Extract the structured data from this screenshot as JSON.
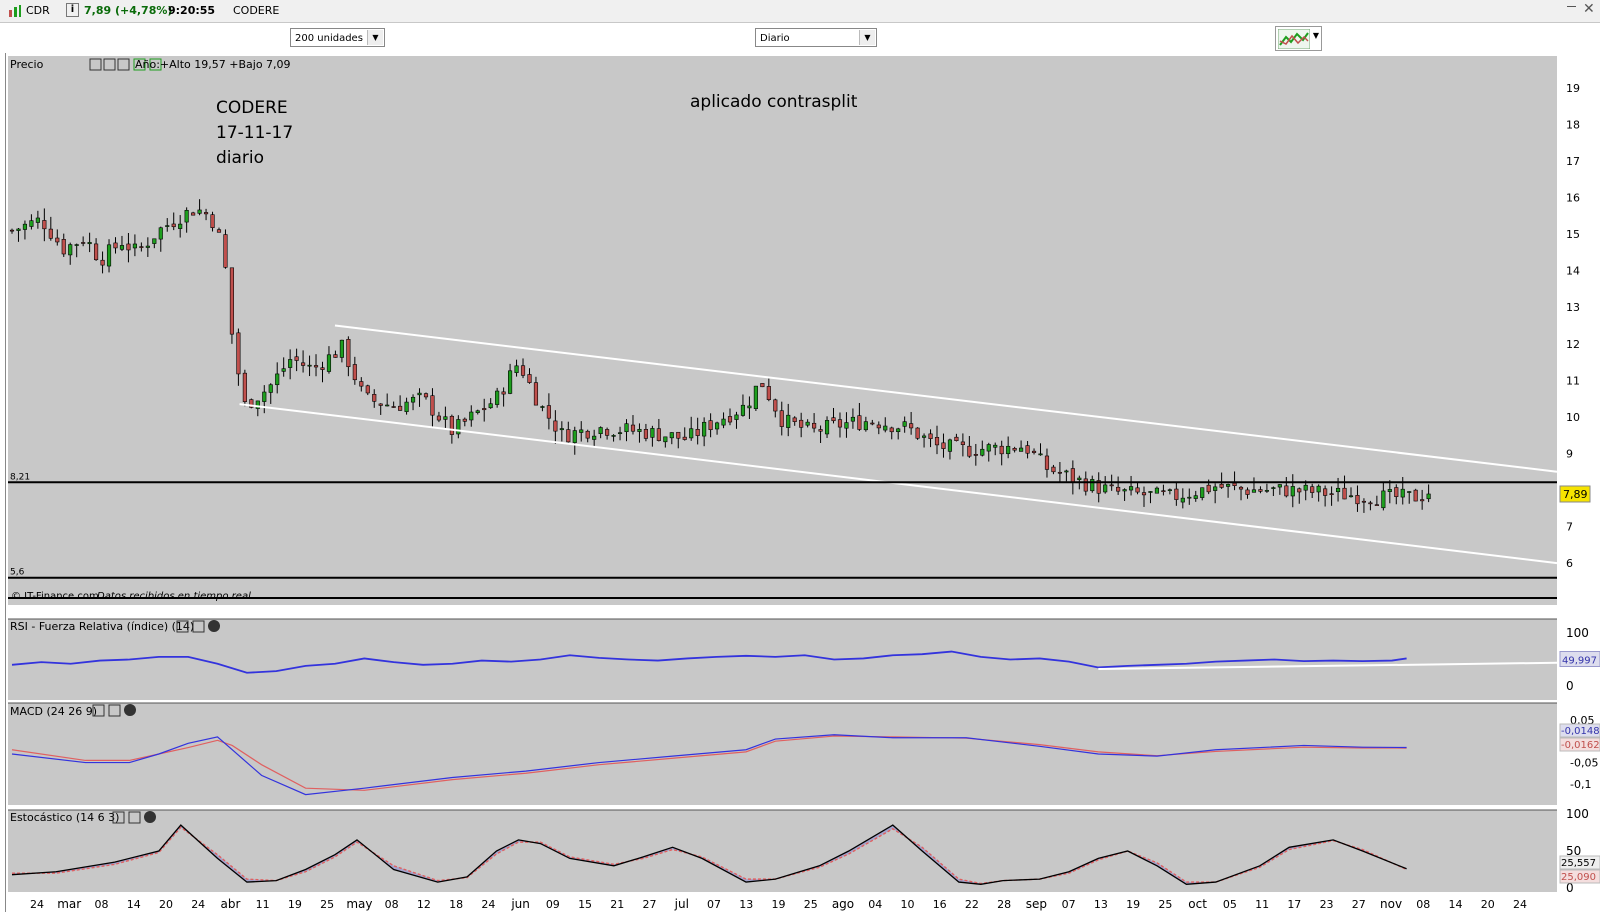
{
  "topbar": {
    "symbol": "CDR",
    "info": "i",
    "price": "7,89 (+4,78%)",
    "time": "9:20:55",
    "name": "CODERE",
    "close": "✕"
  },
  "toolbar": {
    "units": "200 unidades",
    "period": "Diario"
  },
  "panels": {
    "price": {
      "label": "Precio",
      "year_info": "Año:+Alto 19,57 +Bajo 7,09",
      "credit": "© IT-Finance.com",
      "credit2": "Datos recibidos en tiempo real"
    },
    "rsi": {
      "label": "RSI - Fuerza Relativa (índice) (14)"
    },
    "macd": {
      "label": "MACD (24 26 9)"
    },
    "stoch": {
      "label": "Estocástico (14 6 3)"
    }
  },
  "annotations": {
    "title_lines": [
      "CODERE",
      "17-11-17",
      "diario"
    ],
    "note": "aplicado contrasplit"
  },
  "colors": {
    "up": "#1e9e1e",
    "down": "#c0504d",
    "background": "#c8c8c8",
    "blue": "#3333dd",
    "red": "#e06060"
  },
  "chart_data": [
    {
      "type": "candlestick",
      "title": "",
      "y_ticks": [
        6,
        7,
        8,
        9,
        10,
        11,
        12,
        13,
        14,
        15,
        16,
        17,
        18,
        19
      ],
      "ylim": [
        5.4,
        19.6
      ],
      "x_tick_labels": [
        "24",
        "mar",
        "08",
        "14",
        "20",
        "24",
        "abr",
        "11",
        "19",
        "25",
        "may",
        "08",
        "12",
        "18",
        "24",
        "jun",
        "09",
        "15",
        "21",
        "27",
        "jul",
        "07",
        "13",
        "19",
        "25",
        "ago",
        "04",
        "10",
        "16",
        "22",
        "28",
        "sep",
        "07",
        "13",
        "19",
        "25",
        "oct",
        "05",
        "11",
        "17",
        "23",
        "27",
        "nov",
        "08",
        "14",
        "20",
        "24"
      ],
      "horizontal_lines": [
        {
          "value": 8.21,
          "label": "8,21"
        },
        {
          "value": 5.6,
          "label": "5,6"
        }
      ],
      "last_price": {
        "value": 7.89,
        "label": "7,89"
      },
      "trendlines": [
        {
          "name": "upper",
          "from": [
            0.22,
            12.5
          ],
          "to": [
            1.0,
            8.5
          ]
        },
        {
          "name": "lower",
          "from": [
            0.155,
            10.35
          ],
          "to": [
            1.0,
            6.0
          ]
        }
      ],
      "anchors": [
        [
          0,
          15.1
        ],
        [
          0.02,
          15.4
        ],
        [
          0.035,
          14.6
        ],
        [
          0.05,
          14.9
        ],
        [
          0.06,
          14.3
        ],
        [
          0.075,
          14.8
        ],
        [
          0.085,
          14.5
        ],
        [
          0.1,
          15.1
        ],
        [
          0.115,
          15.5
        ],
        [
          0.125,
          15.7
        ],
        [
          0.135,
          15.5
        ],
        [
          0.14,
          15.1
        ],
        [
          0.145,
          14.2
        ],
        [
          0.15,
          12.2
        ],
        [
          0.158,
          10.3
        ],
        [
          0.175,
          10.8
        ],
        [
          0.19,
          11.6
        ],
        [
          0.205,
          11.3
        ],
        [
          0.225,
          11.9
        ],
        [
          0.24,
          10.5
        ],
        [
          0.26,
          10.3
        ],
        [
          0.28,
          10.5
        ],
        [
          0.3,
          9.6
        ],
        [
          0.33,
          10.5
        ],
        [
          0.345,
          11.5
        ],
        [
          0.36,
          10.3
        ],
        [
          0.375,
          9.5
        ],
        [
          0.4,
          9.7
        ],
        [
          0.43,
          9.6
        ],
        [
          0.46,
          9.4
        ],
        [
          0.48,
          9.9
        ],
        [
          0.5,
          10.3
        ],
        [
          0.51,
          11.0
        ],
        [
          0.525,
          9.9
        ],
        [
          0.545,
          9.6
        ],
        [
          0.565,
          9.8
        ],
        [
          0.585,
          9.9
        ],
        [
          0.61,
          9.7
        ],
        [
          0.63,
          9.2
        ],
        [
          0.65,
          9.1
        ],
        [
          0.69,
          9.2
        ],
        [
          0.705,
          8.6
        ],
        [
          0.73,
          8.2
        ],
        [
          0.75,
          7.95
        ],
        [
          0.79,
          7.8
        ],
        [
          0.82,
          8.1
        ],
        [
          0.84,
          8.0
        ],
        [
          0.87,
          8.0
        ],
        [
          0.9,
          7.9
        ],
        [
          0.93,
          7.8
        ],
        [
          0.955,
          7.8
        ],
        [
          0.965,
          7.89
        ]
      ],
      "candle_count": 220
    },
    {
      "type": "line",
      "title": "RSI - Fuerza Relativa (índice) (14)",
      "y_ticks": [
        0,
        100
      ],
      "ylim": [
        0,
        100
      ],
      "last_value": {
        "value": 49.997,
        "label": "49,997"
      },
      "support_line": {
        "from": [
          0.74,
          32
        ],
        "to": [
          1.0,
          45
        ]
      },
      "series": [
        {
          "name": "",
          "x": [
            0,
            0.02,
            0.04,
            0.06,
            0.08,
            0.1,
            0.12,
            0.14,
            0.16,
            0.18,
            0.2,
            0.22,
            0.24,
            0.26,
            0.28,
            0.3,
            0.32,
            0.34,
            0.36,
            0.38,
            0.4,
            0.42,
            0.44,
            0.46,
            0.48,
            0.5,
            0.52,
            0.54,
            0.56,
            0.58,
            0.6,
            0.62,
            0.64,
            0.66,
            0.68,
            0.7,
            0.72,
            0.74,
            0.76,
            0.78,
            0.8,
            0.82,
            0.84,
            0.86,
            0.88,
            0.9,
            0.92,
            0.94,
            0.95
          ],
          "y": [
            40,
            45,
            42,
            48,
            50,
            55,
            55,
            42,
            25,
            28,
            38,
            42,
            52,
            45,
            40,
            42,
            48,
            46,
            50,
            58,
            53,
            50,
            48,
            52,
            55,
            57,
            55,
            58,
            50,
            52,
            58,
            60,
            65,
            55,
            50,
            52,
            46,
            35,
            38,
            40,
            42,
            46,
            48,
            50,
            47,
            48,
            47,
            48,
            52
          ]
        }
      ]
    },
    {
      "type": "line",
      "title": "MACD (24 26 9)",
      "y_ticks": [
        0.05,
        -0.05,
        -0.1
      ],
      "ylim": [
        -0.14,
        0.08
      ],
      "last_values": [
        {
          "value": -0.0148,
          "label": "-0,0148"
        },
        {
          "value": -0.0162,
          "label": "-0,0162"
        }
      ],
      "series": [
        {
          "name": "",
          "color": "#3333dd",
          "x": [
            0,
            0.05,
            0.08,
            0.1,
            0.12,
            0.14,
            0.15,
            0.17,
            0.2,
            0.24,
            0.3,
            0.35,
            0.4,
            0.45,
            0.5,
            0.52,
            0.56,
            0.6,
            0.65,
            0.7,
            0.74,
            0.78,
            0.82,
            0.88,
            0.92,
            0.95
          ],
          "y": [
            -0.03,
            -0.05,
            -0.05,
            -0.03,
            -0.005,
            0.01,
            -0.02,
            -0.08,
            -0.125,
            -0.11,
            -0.085,
            -0.07,
            -0.05,
            -0.035,
            -0.02,
            0.005,
            0.015,
            0.008,
            0.008,
            -0.012,
            -0.03,
            -0.035,
            -0.02,
            -0.01,
            -0.014,
            -0.0148
          ]
        },
        {
          "name": "",
          "color": "#e06060",
          "x": [
            0,
            0.05,
            0.08,
            0.1,
            0.12,
            0.14,
            0.15,
            0.17,
            0.2,
            0.24,
            0.3,
            0.35,
            0.4,
            0.45,
            0.5,
            0.52,
            0.56,
            0.6,
            0.65,
            0.7,
            0.74,
            0.78,
            0.82,
            0.88,
            0.92,
            0.95
          ],
          "y": [
            -0.02,
            -0.045,
            -0.045,
            -0.03,
            -0.015,
            0.002,
            -0.01,
            -0.055,
            -0.11,
            -0.115,
            -0.09,
            -0.075,
            -0.055,
            -0.04,
            -0.025,
            0.0,
            0.012,
            0.01,
            0.007,
            -0.008,
            -0.025,
            -0.034,
            -0.024,
            -0.014,
            -0.016,
            -0.0162
          ]
        }
      ]
    },
    {
      "type": "line",
      "title": "Estocástico (14 6 3)",
      "y_ticks": [
        0,
        50,
        100
      ],
      "ylim": [
        0,
        100
      ],
      "last_values": [
        {
          "value": 25.557,
          "label": "25,557"
        },
        {
          "value": 25.09,
          "label": "25,090"
        }
      ],
      "series": [
        {
          "name": "",
          "color": "#000000",
          "x": [
            0,
            0.03,
            0.07,
            0.1,
            0.115,
            0.14,
            0.16,
            0.18,
            0.2,
            0.22,
            0.235,
            0.26,
            0.29,
            0.31,
            0.33,
            0.345,
            0.36,
            0.38,
            0.41,
            0.43,
            0.45,
            0.47,
            0.5,
            0.52,
            0.55,
            0.57,
            0.6,
            0.62,
            0.645,
            0.66,
            0.675,
            0.7,
            0.72,
            0.74,
            0.76,
            0.78,
            0.8,
            0.82,
            0.85,
            0.87,
            0.9,
            0.92,
            0.95
          ],
          "y": [
            18,
            22,
            35,
            50,
            85,
            40,
            8,
            10,
            25,
            45,
            65,
            25,
            8,
            15,
            50,
            65,
            60,
            40,
            30,
            42,
            55,
            40,
            8,
            12,
            30,
            50,
            85,
            50,
            8,
            5,
            10,
            12,
            22,
            40,
            50,
            30,
            5,
            8,
            30,
            55,
            65,
            50,
            26
          ]
        },
        {
          "name": "",
          "color": "#e06060",
          "x": [
            0,
            0.03,
            0.07,
            0.1,
            0.115,
            0.14,
            0.16,
            0.18,
            0.2,
            0.22,
            0.235,
            0.26,
            0.29,
            0.31,
            0.33,
            0.345,
            0.36,
            0.38,
            0.41,
            0.43,
            0.45,
            0.47,
            0.5,
            0.52,
            0.55,
            0.57,
            0.6,
            0.62,
            0.645,
            0.66,
            0.675,
            0.7,
            0.72,
            0.74,
            0.76,
            0.78,
            0.8,
            0.82,
            0.85,
            0.87,
            0.9,
            0.92,
            0.95
          ],
          "y": [
            20,
            20,
            32,
            48,
            82,
            45,
            12,
            10,
            22,
            42,
            62,
            30,
            10,
            14,
            46,
            62,
            62,
            42,
            32,
            40,
            52,
            42,
            12,
            12,
            28,
            46,
            80,
            55,
            12,
            6,
            10,
            12,
            20,
            38,
            50,
            34,
            8,
            8,
            28,
            52,
            64,
            52,
            25
          ]
        }
      ]
    }
  ]
}
